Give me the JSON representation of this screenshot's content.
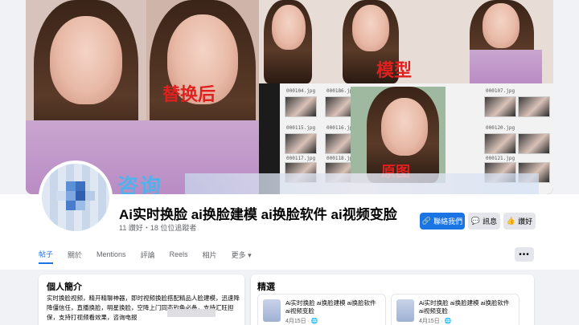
{
  "cover": {
    "caption_replaced": "替换后",
    "caption_model": "模型",
    "caption_original": "原图",
    "watermark": "咨询",
    "thumbnails": [
      "000104.jpg",
      "000186.jpg",
      "000107.jpg",
      "000115.jpg",
      "000116.jpg",
      "000120.jpg",
      "000117.jpg",
      "000118.jpg",
      "000121.jpg"
    ]
  },
  "page": {
    "name": "Ai实时换脸 ai换脸建模 ai换脸软件 ai视频变脸",
    "stats": "11 讚好・18 位位追蹤者"
  },
  "actions": {
    "contact": "聯絡我們",
    "message": "訊息",
    "like": "讚好"
  },
  "tabs": [
    "帖子",
    "關於",
    "Mentions",
    "評論",
    "Reels",
    "相片",
    "更多 ▾"
  ],
  "more_label": "•••",
  "intro": {
    "title": "個人簡介",
    "text": "实时换脸视频，精开精聊神器，即时视频换脸搭配精品人脸建模，迅速降降僵信任，直播换脸，明星换脸，空降上门同态钓鱼必备，支持汇旺担保，支持打视频看效果，咨询电报"
  },
  "featured": {
    "title": "精選",
    "posts": [
      {
        "text": "Ai实时换脸 ai换脸建模 ai换脸软件 ai视频变脸",
        "date": "4月15日 · 🌐"
      },
      {
        "text": "Ai实时换脸 ai换脸建模 ai换脸软件 ai视频变脸",
        "date": "4月15日 · 🌐"
      }
    ]
  },
  "colors": {
    "accent": "#1b74e4",
    "overlay_red": "#e0201f",
    "watermark_blue": "#47b5ef"
  }
}
